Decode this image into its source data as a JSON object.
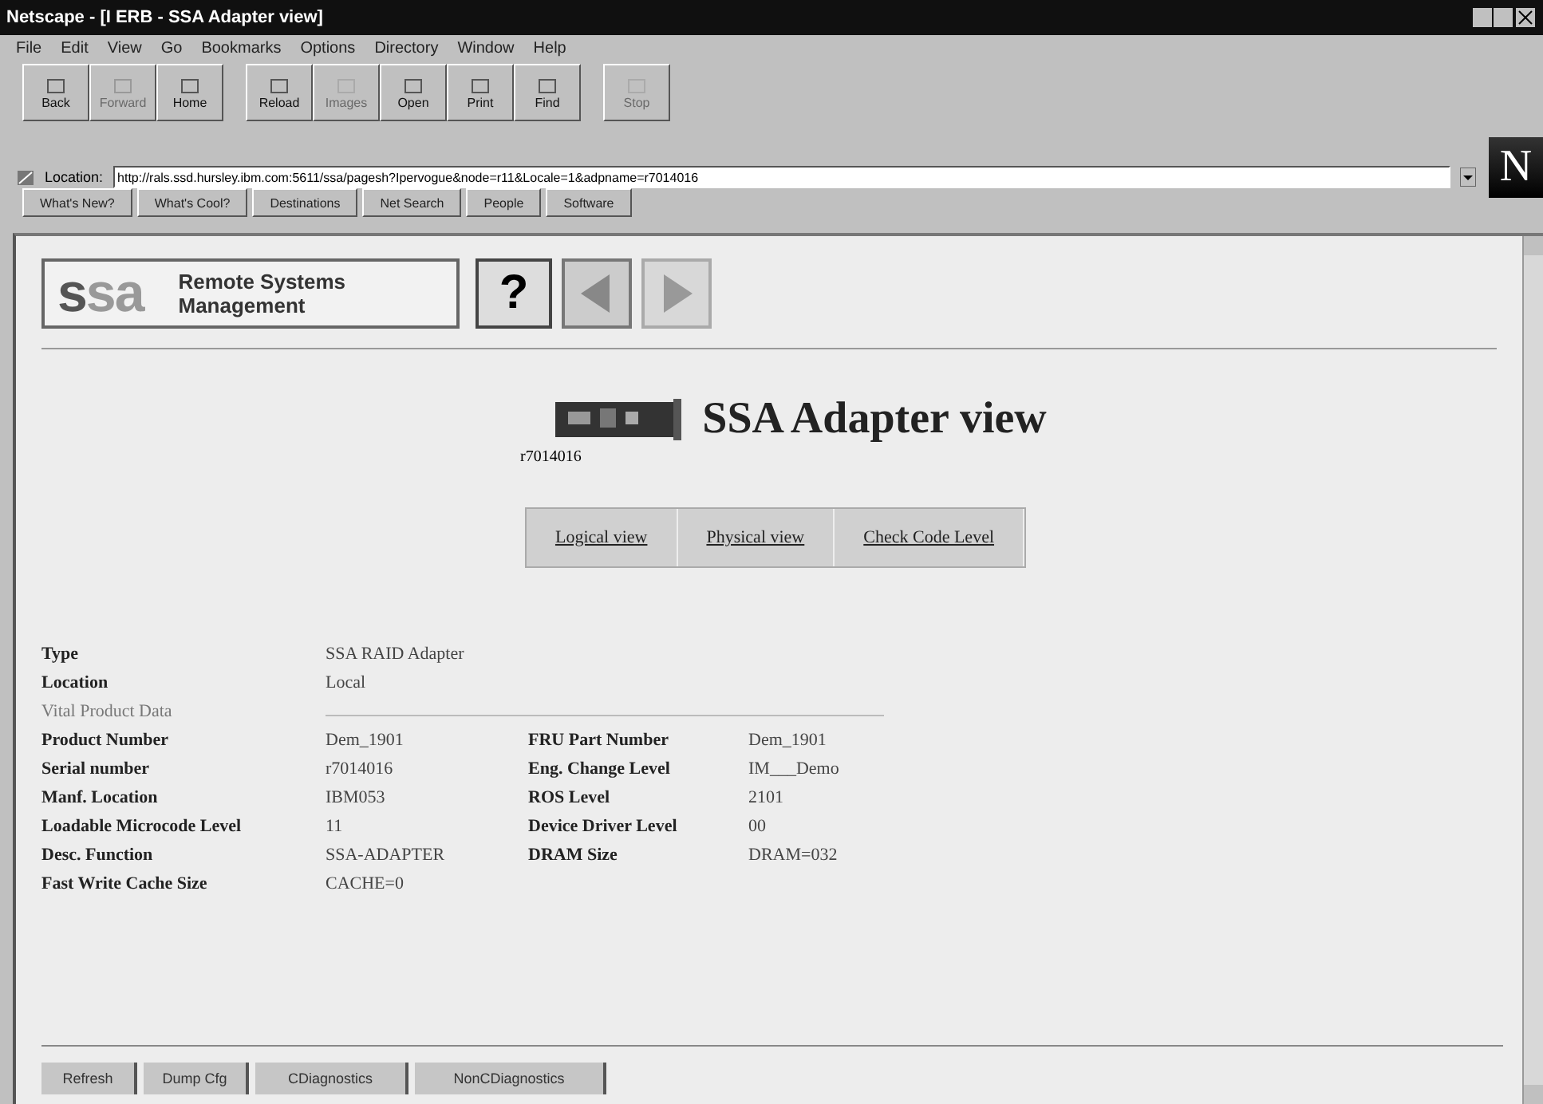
{
  "window": {
    "title": "Netscape - [I ERB - SSA Adapter view]"
  },
  "menu": [
    "File",
    "Edit",
    "View",
    "Go",
    "Bookmarks",
    "Options",
    "Directory",
    "Window",
    "Help"
  ],
  "toolbar": [
    {
      "label": "Back",
      "disabled": false
    },
    {
      "label": "Forward",
      "disabled": true
    },
    {
      "label": "Home",
      "disabled": false
    },
    {
      "label": "Reload",
      "disabled": false
    },
    {
      "label": "Images",
      "disabled": true
    },
    {
      "label": "Open",
      "disabled": false
    },
    {
      "label": "Print",
      "disabled": false
    },
    {
      "label": "Find",
      "disabled": false
    },
    {
      "label": "Stop",
      "disabled": true
    }
  ],
  "location": {
    "label": "Location:",
    "url": "http://rals.ssd.hursley.ibm.com:5611/ssa/pagesh?Ipervogue&node=r11&Locale=1&adpname=r7014016"
  },
  "brand": "N",
  "directory_buttons": [
    "What's New?",
    "What's Cool?",
    "Destinations",
    "Net Search",
    "People",
    "Software"
  ],
  "page": {
    "logo": "ssa",
    "logo_caption": "Remote Systems Management",
    "help": "?",
    "heading": "SSA Adapter view",
    "adapter_id": "r7014016",
    "views": [
      "Logical view",
      "Physical view",
      "Check Code Level"
    ],
    "summary": [
      {
        "label": "Type",
        "value": "SSA RAID Adapter"
      },
      {
        "label": "Location",
        "value": "Local"
      }
    ],
    "section": "Vital Product Data",
    "vpd": [
      [
        "Product Number",
        "Dem_1901",
        "FRU Part Number",
        "Dem_1901"
      ],
      [
        "Serial number",
        "r7014016",
        "Eng. Change Level",
        "IM___Demo"
      ],
      [
        "Manf. Location",
        "IBM053",
        "ROS Level",
        "2101"
      ],
      [
        "Loadable Microcode Level",
        "11",
        "Device Driver Level",
        "00"
      ],
      [
        "Desc. Function",
        "SSA-ADAPTER",
        "DRAM Size",
        "DRAM=032"
      ],
      [
        "Fast Write Cache Size",
        "CACHE=0"
      ]
    ],
    "actions": [
      "Refresh",
      "Dump Cfg",
      "CDiagnostics",
      "NonCDiagnostics"
    ]
  }
}
